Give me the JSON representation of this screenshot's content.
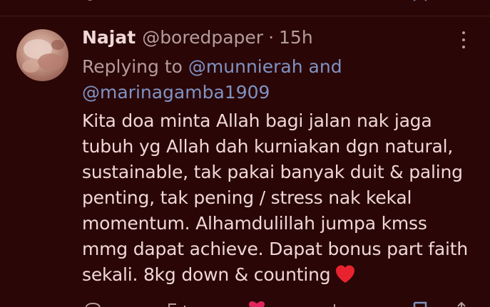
{
  "tweet": {
    "author_name": "Najat",
    "handle": "@boredpaper",
    "separator": "·",
    "time": "15h",
    "replying_prefix": "Replying to",
    "replying_to_1": "@munnierah",
    "replying_conj": "and",
    "replying_to_2": "@marinagamba1909",
    "text_lines": [
      "Kita doa minta Allah bagi jalan nak jaga",
      "tubuh yg Allah dah kurniakan dgn natural,",
      "sustainable, tak pakai banyak duit & paling",
      "penting, tak pening / stress nak kekal",
      "momentum. Alhamdulillah jumpa kmss",
      "mmg dapat achieve. Dapat bonus part faith",
      "sekali. 8kg down & counting"
    ],
    "emoji": "red-heart-emoji"
  },
  "icons": {
    "more": "more-vertical-icon",
    "reply": "reply-icon",
    "retweet": "retweet-icon",
    "like": "heart-icon",
    "views": "views-icon",
    "bookmark": "bookmark-icon",
    "share": "share-icon"
  },
  "colors": {
    "background": "#2a0606",
    "text": "#f0d7d7",
    "muted": "#b59c9c",
    "link": "#7f93c4",
    "heart": "#e0245e"
  }
}
